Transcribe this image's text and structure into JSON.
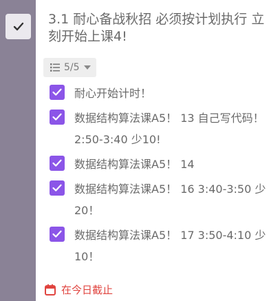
{
  "task": {
    "title": "3.1 耐心备战秋招 必须按计划执行 立刻开始上课4!",
    "completed": true
  },
  "subtask_counter": {
    "text": "5/5",
    "icon": "list-icon"
  },
  "subtasks": [
    {
      "label": "耐心开始计时！",
      "checked": true
    },
    {
      "label": "数据结构算法课A5！ 13 自己写代码！ 2:50-3:40 少10!",
      "checked": true
    },
    {
      "label": "数据结构算法课A5！ 14",
      "checked": true
    },
    {
      "label": "数据结构算法课A5！ 16 3:40-3:50 少20！",
      "checked": true
    },
    {
      "label": "数据结构算法课A5！ 17 3:50-4:10 少10！",
      "checked": true
    }
  ],
  "due": {
    "text": "在今日截止",
    "icon": "calendar-icon"
  },
  "colors": {
    "sidebar": "#8a8296",
    "checkbox_accent": "#8b55e8",
    "due_red": "#e0443f"
  }
}
